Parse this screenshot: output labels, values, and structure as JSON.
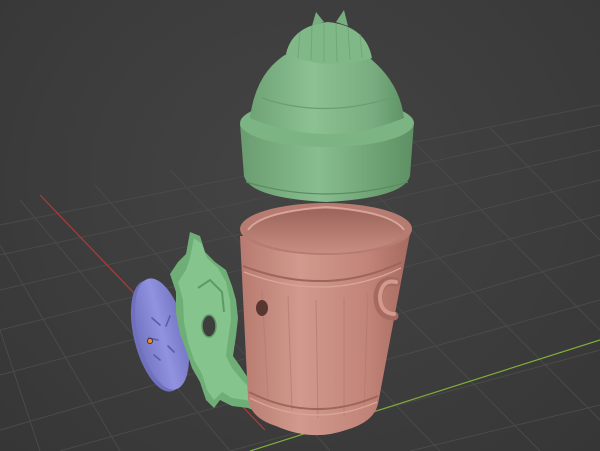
{
  "viewport": {
    "background": "#3d3d3d",
    "grid_color": "#4a4a4a",
    "x_axis_color": "#b03a3a",
    "y_axis_color": "#7fae3a"
  },
  "objects": [
    {
      "name": "dome-lid",
      "color": "#7fb086"
    },
    {
      "name": "pot-body",
      "color": "#c48a80"
    },
    {
      "name": "gear-bracket",
      "color": "#7fbf86"
    },
    {
      "name": "disc-cap",
      "color": "#8a8cd8"
    }
  ],
  "icons": [
    "origin-marker-icon"
  ]
}
